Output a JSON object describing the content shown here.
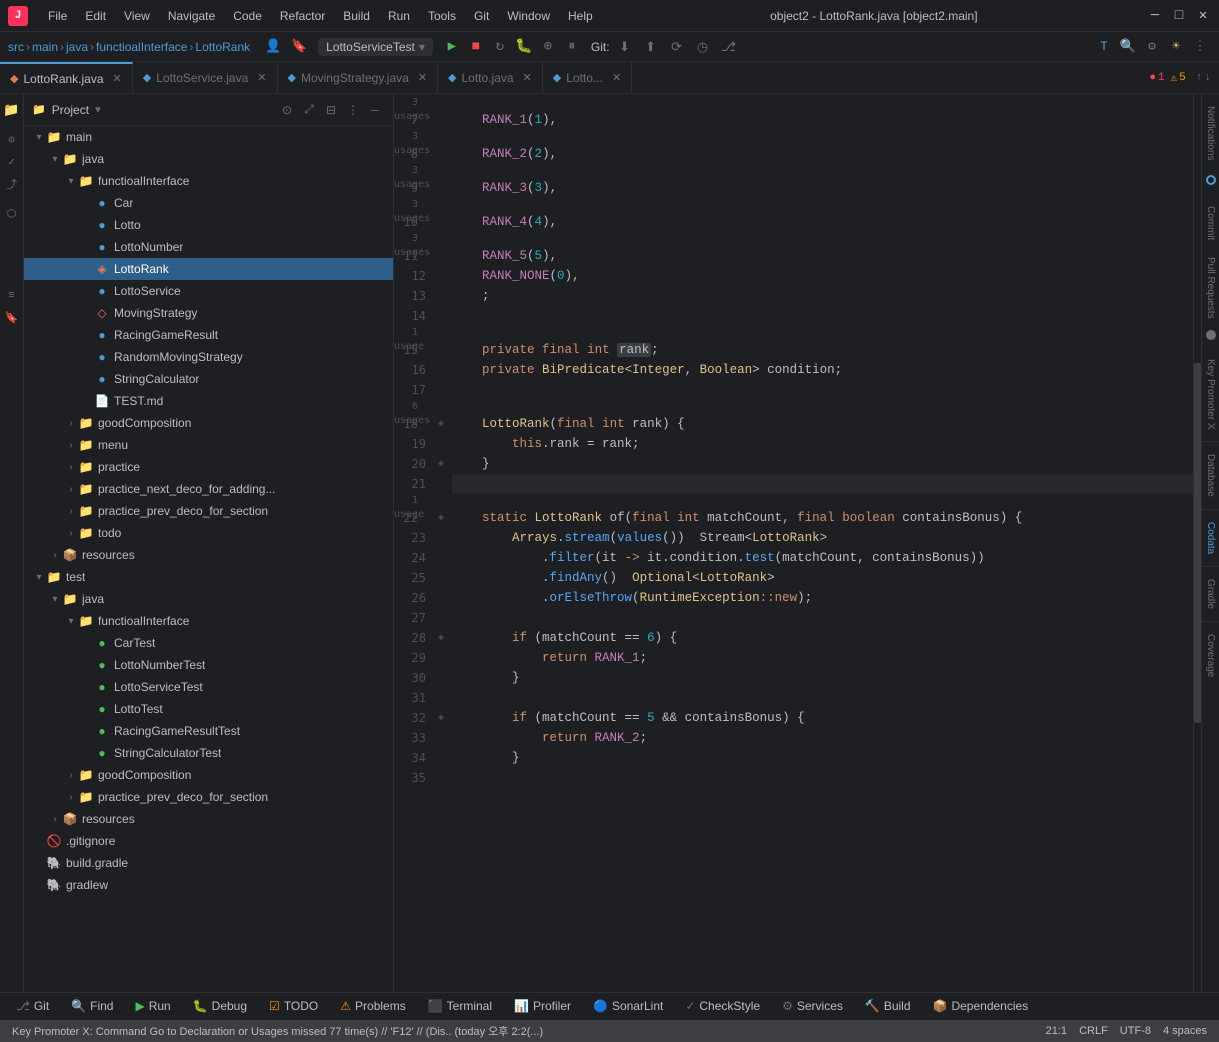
{
  "app": {
    "title": "object2 - LottoRank.java [object2.main]",
    "logo": "J"
  },
  "titlebar": {
    "menus": [
      "File",
      "Edit",
      "View",
      "Navigate",
      "Code",
      "Refactor",
      "Build",
      "Run",
      "Tools",
      "Git",
      "Window",
      "Help"
    ],
    "controls": [
      "─",
      "□",
      "✕"
    ]
  },
  "navbar": {
    "breadcrumb": [
      "src",
      "main",
      "java",
      "functioalInterface",
      "LottoRank"
    ],
    "run_config": "LottoServiceTest",
    "git_label": "Git:"
  },
  "tabs": [
    {
      "label": "LottoRank.java",
      "active": true,
      "color": "#e07b53"
    },
    {
      "label": "LottoService.java",
      "active": false,
      "color": "#4b9cd3"
    },
    {
      "label": "MovingStrategy.java",
      "active": false,
      "color": "#4b9cd3"
    },
    {
      "label": "Lotto.java",
      "active": false,
      "color": "#4b9cd3"
    },
    {
      "label": "Lotto...",
      "active": false,
      "color": "#4b9cd3"
    }
  ],
  "error_badge": {
    "errors": "1",
    "warnings": "5"
  },
  "project_panel": {
    "title": "Project",
    "tree": [
      {
        "level": 0,
        "label": "main",
        "type": "folder",
        "expanded": true
      },
      {
        "level": 1,
        "label": "java",
        "type": "folder-java",
        "expanded": true
      },
      {
        "level": 2,
        "label": "functioalInterface",
        "type": "folder",
        "expanded": true
      },
      {
        "level": 3,
        "label": "Car",
        "type": "class"
      },
      {
        "level": 3,
        "label": "Lotto",
        "type": "class"
      },
      {
        "level": 3,
        "label": "LottoNumber",
        "type": "class"
      },
      {
        "level": 3,
        "label": "LottoRank",
        "type": "enum",
        "selected": true
      },
      {
        "level": 3,
        "label": "LottoService",
        "type": "class"
      },
      {
        "level": 3,
        "label": "MovingStrategy",
        "type": "interface"
      },
      {
        "level": 3,
        "label": "RacingGameResult",
        "type": "class"
      },
      {
        "level": 3,
        "label": "RandomMovingStrategy",
        "type": "class"
      },
      {
        "level": 3,
        "label": "StringCalculator",
        "type": "class"
      },
      {
        "level": 3,
        "label": "TEST.md",
        "type": "md"
      },
      {
        "level": 2,
        "label": "goodComposition",
        "type": "folder",
        "expanded": false
      },
      {
        "level": 2,
        "label": "menu",
        "type": "folder",
        "expanded": false
      },
      {
        "level": 2,
        "label": "practice",
        "type": "folder",
        "expanded": false
      },
      {
        "level": 2,
        "label": "practice_next_deco_for_adding...",
        "type": "folder",
        "expanded": false
      },
      {
        "level": 2,
        "label": "practice_prev_deco_for_section",
        "type": "folder",
        "expanded": false
      },
      {
        "level": 2,
        "label": "todo",
        "type": "folder",
        "expanded": false
      },
      {
        "level": 1,
        "label": "resources",
        "type": "resources",
        "expanded": false
      },
      {
        "level": 0,
        "label": "test",
        "type": "folder-test",
        "expanded": true
      },
      {
        "level": 1,
        "label": "java",
        "type": "folder-java-test",
        "expanded": true
      },
      {
        "level": 2,
        "label": "functioalInterface",
        "type": "folder",
        "expanded": true
      },
      {
        "level": 3,
        "label": "CarTest",
        "type": "class-test"
      },
      {
        "level": 3,
        "label": "LottoNumberTest",
        "type": "class-test"
      },
      {
        "level": 3,
        "label": "LottoServiceTest",
        "type": "class-test"
      },
      {
        "level": 3,
        "label": "LottoTest",
        "type": "class-test"
      },
      {
        "level": 3,
        "label": "RacingGameResultTest",
        "type": "class-test"
      },
      {
        "level": 3,
        "label": "StringCalculatorTest",
        "type": "class-test"
      },
      {
        "level": 2,
        "label": "goodComposition",
        "type": "folder",
        "expanded": false
      },
      {
        "level": 2,
        "label": "practice_prev_deco_for_section",
        "type": "folder",
        "expanded": false
      },
      {
        "level": 1,
        "label": "resources",
        "type": "resources",
        "expanded": false
      },
      {
        "level": 0,
        "label": ".gitignore",
        "type": "gitignore"
      },
      {
        "level": 0,
        "label": "build.gradle",
        "type": "gradle"
      },
      {
        "level": 0,
        "label": "gradlew",
        "type": "gradle"
      }
    ]
  },
  "code": {
    "lines": [
      {
        "num": 7,
        "hint": "3 usages",
        "code": "    RANK_1(1),"
      },
      {
        "num": 8,
        "hint": "3 usages",
        "code": "    RANK_2(2),"
      },
      {
        "num": 9,
        "hint": "3 usages",
        "code": "    RANK_3(3),"
      },
      {
        "num": 10,
        "hint": "3 usages",
        "code": "    RANK_4(4),"
      },
      {
        "num": 11,
        "hint": "3 usages",
        "code": "    RANK_5(5),"
      },
      {
        "num": 12,
        "hint": "",
        "code": "    RANK_NONE(0),"
      },
      {
        "num": 13,
        "hint": "",
        "code": "    ;"
      },
      {
        "num": 14,
        "hint": "",
        "code": ""
      },
      {
        "num": 15,
        "hint": "1 usage",
        "code": "    private final int rank;"
      },
      {
        "num": 16,
        "hint": "",
        "code": "    private BiPredicate<Integer, Boolean> condition;"
      },
      {
        "num": 17,
        "hint": "",
        "code": ""
      },
      {
        "num": 18,
        "hint": "6 usages",
        "code": "    LottoRank(final int rank) {"
      },
      {
        "num": 19,
        "hint": "",
        "code": "        this.rank = rank;"
      },
      {
        "num": 20,
        "hint": "",
        "code": "    }"
      },
      {
        "num": 21,
        "hint": "",
        "code": ""
      },
      {
        "num": 22,
        "hint": "1 usage",
        "code": "    static LottoRank of(final int matchCount, final boolean containsBonus) {"
      },
      {
        "num": 23,
        "hint": "",
        "code": "        Arrays.stream(values())  Stream<LottoRank>"
      },
      {
        "num": 24,
        "hint": "",
        "code": "            .filter(it -> it.condition.test(matchCount, containsBonus))"
      },
      {
        "num": 25,
        "hint": "",
        "code": "            .findAny()  Optional<LottoRank>"
      },
      {
        "num": 26,
        "hint": "",
        "code": "            .orElseThrow(RuntimeException::new);"
      },
      {
        "num": 27,
        "hint": "",
        "code": ""
      },
      {
        "num": 28,
        "hint": "",
        "code": "        if (matchCount == 6) {"
      },
      {
        "num": 29,
        "hint": "",
        "code": "            return RANK_1;"
      },
      {
        "num": 30,
        "hint": "",
        "code": "        }"
      },
      {
        "num": 31,
        "hint": "",
        "code": ""
      },
      {
        "num": 32,
        "hint": "",
        "code": "        if (matchCount == 5 && containsBonus) {"
      },
      {
        "num": 33,
        "hint": "",
        "code": "            return RANK_2;"
      },
      {
        "num": 34,
        "hint": "",
        "code": "        }"
      },
      {
        "num": 35,
        "hint": "",
        "code": ""
      }
    ]
  },
  "statusbar": {
    "git": "Git",
    "find": "Find",
    "run": "Run",
    "debug": "Debug",
    "todo": "TODO",
    "problems": "Problems",
    "terminal": "Terminal",
    "profiler": "Profiler",
    "sonarLint": "SonarLint",
    "checkStyle": "CheckStyle",
    "services": "Services",
    "build": "Build",
    "dependencies": "Dependencies",
    "position": "21:1",
    "encoding": "CRLF",
    "charset": "UTF-8",
    "indent": "4 spaces",
    "bottom_msg": "Key Promoter X: Command Go to Declaration or Usages missed 77 time(s) // 'F12' // (Dis.. (today 오후 2:2(...)"
  },
  "right_panels": {
    "notifications": "Notifications",
    "commit": "Commit",
    "pull_requests": "Pull Requests",
    "key_promoter": "Key Promoter X",
    "database": "Database",
    "codata": "Codata",
    "gradle": "Gradle",
    "coverage": "Coverage"
  }
}
